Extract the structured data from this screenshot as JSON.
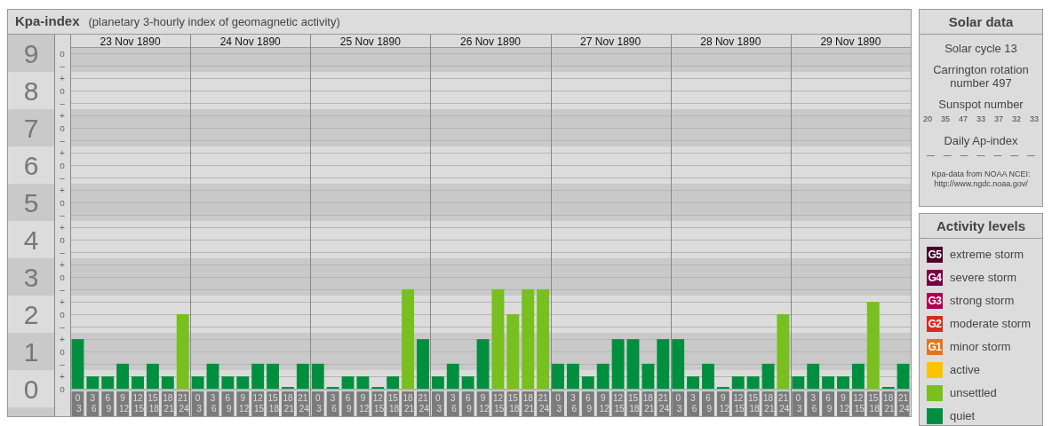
{
  "kp_panel": {
    "title": "Kpa-index",
    "subtitle": "(planetary 3-hourly index of geomagnetic activity)",
    "days": [
      "23 Nov 1890",
      "24 Nov 1890",
      "25 Nov 1890",
      "26 Nov 1890",
      "27 Nov 1890",
      "28 Nov 1890",
      "29 Nov 1890"
    ],
    "subdivision_marks": [
      "o",
      "–",
      "+",
      "o",
      "–",
      "+",
      "o",
      "–",
      "+",
      "o",
      "–",
      "+",
      "o",
      "–",
      "+",
      "o",
      "–",
      "+",
      "o",
      "–",
      "+",
      "o",
      "–",
      "+",
      "o",
      "–",
      "+",
      "o"
    ],
    "chart_data": {
      "type": "bar",
      "stacked": true,
      "grid": true,
      "ylim": [
        -0.75,
        9.5
      ],
      "categories": [
        "0 3",
        "3 6",
        "6 9",
        "9 12",
        "12 15",
        "15 18",
        "18 21",
        "21 24",
        "0 3",
        "3 6",
        "6 9",
        "9 12",
        "12 15",
        "15 18",
        "18 21",
        "21 24",
        "0 3",
        "3 6",
        "6 9",
        "9 12",
        "12 15",
        "15 18",
        "18 21",
        "21 24",
        "0 3",
        "3 6",
        "6 9",
        "9 12",
        "12 15",
        "15 18",
        "18 21",
        "21 24",
        "0 3",
        "3 6",
        "6 9",
        "9 12",
        "12 15",
        "15 18",
        "18 21",
        "21 24",
        "0 3",
        "3 6",
        "6 9",
        "9 12",
        "12 15",
        "15 18",
        "18 21",
        "21 24",
        "0 3",
        "3 6",
        "6 9",
        "9 12",
        "12 15",
        "15 18",
        "18 21",
        "21 24"
      ],
      "yticks": [
        {
          "value": 9,
          "label": "9"
        },
        {
          "value": 8,
          "label": "8"
        },
        {
          "value": 7,
          "label": "7"
        },
        {
          "value": 6,
          "label": "6"
        },
        {
          "value": 5,
          "label": "5"
        },
        {
          "value": 4,
          "label": "4"
        },
        {
          "value": 3,
          "label": "3"
        },
        {
          "value": 2,
          "label": "2"
        },
        {
          "value": 1,
          "label": "1"
        },
        {
          "value": 0,
          "label": "0"
        }
      ],
      "series": [
        {
          "color": "#008f3f",
          "values": [
            1.33,
            0.33,
            0.33,
            0.67,
            0.33,
            0.67,
            0.33,
            null,
            0.33,
            0.67,
            0.33,
            0.33,
            0.67,
            0.67,
            0,
            0.67,
            0.67,
            0,
            0.33,
            0.33,
            0,
            0.33,
            null,
            1.33,
            0.33,
            0.67,
            0.33,
            1.33,
            null,
            null,
            null,
            null,
            0.67,
            0.67,
            0.33,
            0.67,
            1.33,
            1.33,
            0.67,
            1.33,
            1.33,
            0.33,
            0.67,
            0,
            0.33,
            0.33,
            0.67,
            null,
            0.33,
            0.67,
            0.33,
            0.33,
            0.67,
            null,
            0,
            0.67
          ]
        },
        {
          "color": "#78bf1f",
          "values": [
            null,
            null,
            null,
            null,
            null,
            null,
            null,
            2,
            null,
            null,
            null,
            null,
            null,
            null,
            null,
            null,
            null,
            null,
            null,
            null,
            null,
            null,
            2.67,
            null,
            null,
            null,
            null,
            null,
            2.67,
            2,
            2.67,
            2.67,
            null,
            null,
            null,
            null,
            null,
            null,
            null,
            null,
            null,
            null,
            null,
            null,
            null,
            null,
            null,
            2,
            null,
            null,
            null,
            null,
            null,
            2.33,
            null,
            null
          ]
        }
      ]
    }
  },
  "solar_data": {
    "title": "Solar data",
    "solar_cycle": "Solar cycle 13",
    "carrington": "Carrington rotation number 497",
    "sunspot_heading": "Sunspot number",
    "sunspots": [
      "20",
      "35",
      "47",
      "33",
      "37",
      "32",
      "33"
    ],
    "ap_heading": "Daily Ap-index",
    "ap_values": [
      "—",
      "—",
      "—",
      "—",
      "—",
      "—",
      "—"
    ],
    "source_lines": [
      "Kpa-data from NOAA NCEI:",
      "http://www.ngdc.noaa.gov/"
    ]
  },
  "activity_levels": {
    "title": "Activity levels",
    "items": [
      {
        "badge": "G5",
        "label": "extreme storm",
        "color": "#4a0028"
      },
      {
        "badge": "G4",
        "label": "severe storm",
        "color": "#780046"
      },
      {
        "badge": "G3",
        "label": "strong storm",
        "color": "#b0004f"
      },
      {
        "badge": "G2",
        "label": "moderate storm",
        "color": "#d9291c"
      },
      {
        "badge": "G1",
        "label": "minor storm",
        "color": "#e8741a"
      },
      {
        "label": "active",
        "color": "#fcc400"
      },
      {
        "label": "unsettled",
        "color": "#78bf1f"
      },
      {
        "label": "quiet",
        "color": "#008f3f"
      }
    ]
  }
}
